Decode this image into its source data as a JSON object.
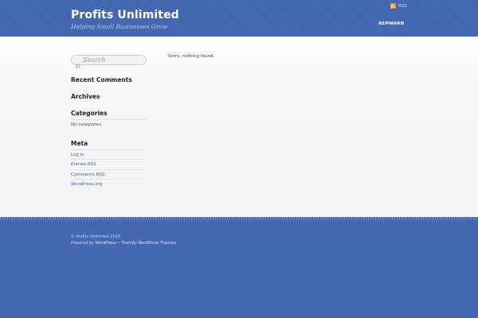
{
  "header": {
    "site_title": "Profits Unlimited",
    "tagline": "Helping Small Businesses Grow",
    "rss_label": "RSS",
    "nav_items": [
      "REPWARN"
    ]
  },
  "sidebar": {
    "search_placeholder": "Search",
    "recent_comments_title": "Recent Comments",
    "archives_title": "Archives",
    "categories_title": "Categories",
    "categories_empty": "No categories",
    "meta_title": "Meta",
    "meta_links": [
      "Log in",
      "Entries RSS",
      "Comments RSS",
      "WordPress.org"
    ]
  },
  "content": {
    "message": "Sorry, nothing found."
  },
  "footer": {
    "copyright": "© Profits Unlimited 2016",
    "powered_prefix": "Powered by",
    "wordpress_link": "WordPress",
    "separator": " • ",
    "themify_link": "Themify WordPress Themes"
  },
  "colors": {
    "header_bg": "#4266b0",
    "link": "#3d5fa8",
    "rss": "#f08a24"
  }
}
